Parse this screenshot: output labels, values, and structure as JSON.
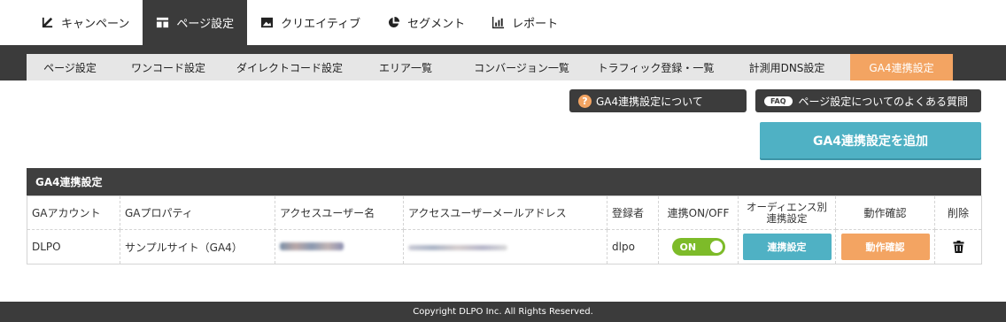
{
  "top_tabs": [
    {
      "label": "キャンペーン",
      "icon": "campaign-icon"
    },
    {
      "label": "ページ設定",
      "icon": "page-layout-icon",
      "active": true
    },
    {
      "label": "クリエイティブ",
      "icon": "image-icon"
    },
    {
      "label": "セグメント",
      "icon": "pie-chart-icon"
    },
    {
      "label": "レポート",
      "icon": "bar-chart-icon"
    }
  ],
  "sub_tabs": [
    {
      "label": "ページ設定"
    },
    {
      "label": "ワンコード設定"
    },
    {
      "label": "ダイレクトコード設定"
    },
    {
      "label": "エリア一覧"
    },
    {
      "label": "コンバージョン一覧"
    },
    {
      "label": "トラフィック登録・一覧"
    },
    {
      "label": "計測用DNS設定"
    },
    {
      "label": "GA4連携設定",
      "active": true
    }
  ],
  "help": {
    "ga4_label": "GA4連携設定について",
    "faq_badge": "FAQ",
    "faq_label": "ページ設定についてのよくある質問"
  },
  "add_button_label": "GA4連携設定を追加",
  "panel_title": "GA4連携設定",
  "table": {
    "headers": [
      "GAアカウント",
      "GAプロパティ",
      "アクセスユーザー名",
      "アクセスユーザーメールアドレス",
      "登録者",
      "連携ON/OFF",
      "オーディエンス別連携設定",
      "動作確認",
      "削除"
    ],
    "audience_header_line1": "オーディエンス別",
    "audience_header_line2": "連携設定",
    "rows": [
      {
        "account": "DLPO",
        "property": "サンプルサイト（GA4）",
        "registrant": "dlpo",
        "toggle_label": "ON",
        "link_button": "連携設定",
        "check_button": "動作確認"
      }
    ]
  },
  "footer": "Copyright DLPO Inc. All Rights Reserved.",
  "colors": {
    "dark": "#3b3b3b",
    "accent_orange": "#f3a462",
    "accent_blue": "#4fb1c4",
    "toggle_green": "#7dbb29"
  }
}
